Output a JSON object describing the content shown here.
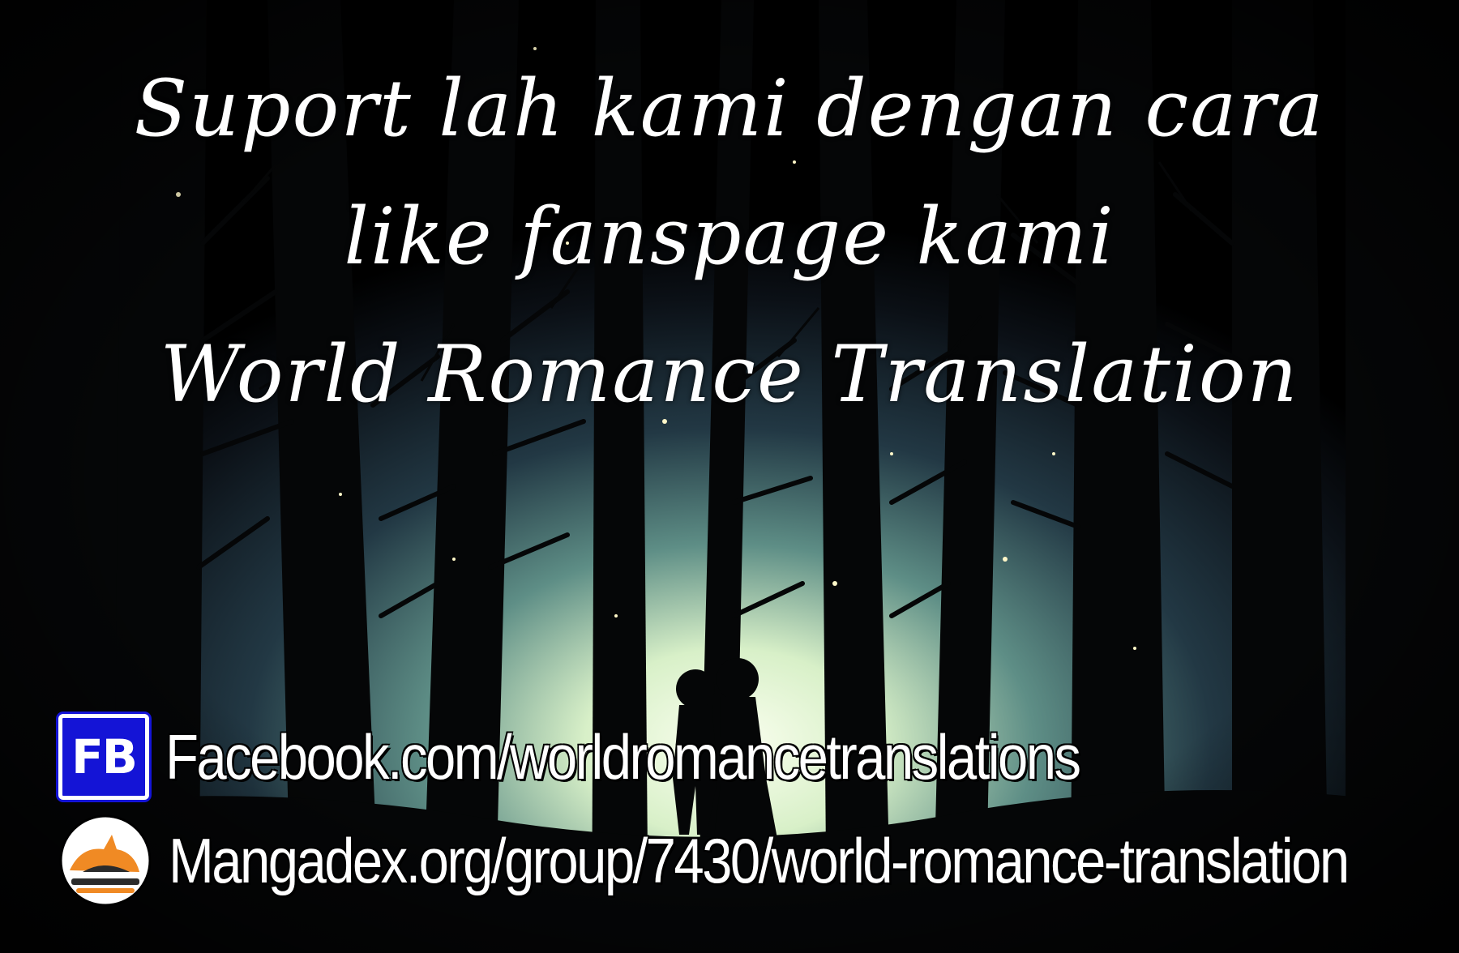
{
  "headline": {
    "line1": "Suport lah kami dengan cara",
    "line2": "like fanspage kami",
    "line3": "World Romance Translation"
  },
  "links": {
    "facebook": {
      "badge": "FB",
      "icon": "facebook-icon",
      "text": "Facebook.com/worldromancetranslations"
    },
    "mangadex": {
      "icon": "mangadex-cat-icon",
      "text": "Mangadex.org/group/7430/world-romance-translation"
    }
  },
  "colors": {
    "fb_blue": "#1414d6",
    "mangadex_orange": "#f08a24",
    "sky_glow": "#d8f0c8",
    "background": "#000000"
  }
}
